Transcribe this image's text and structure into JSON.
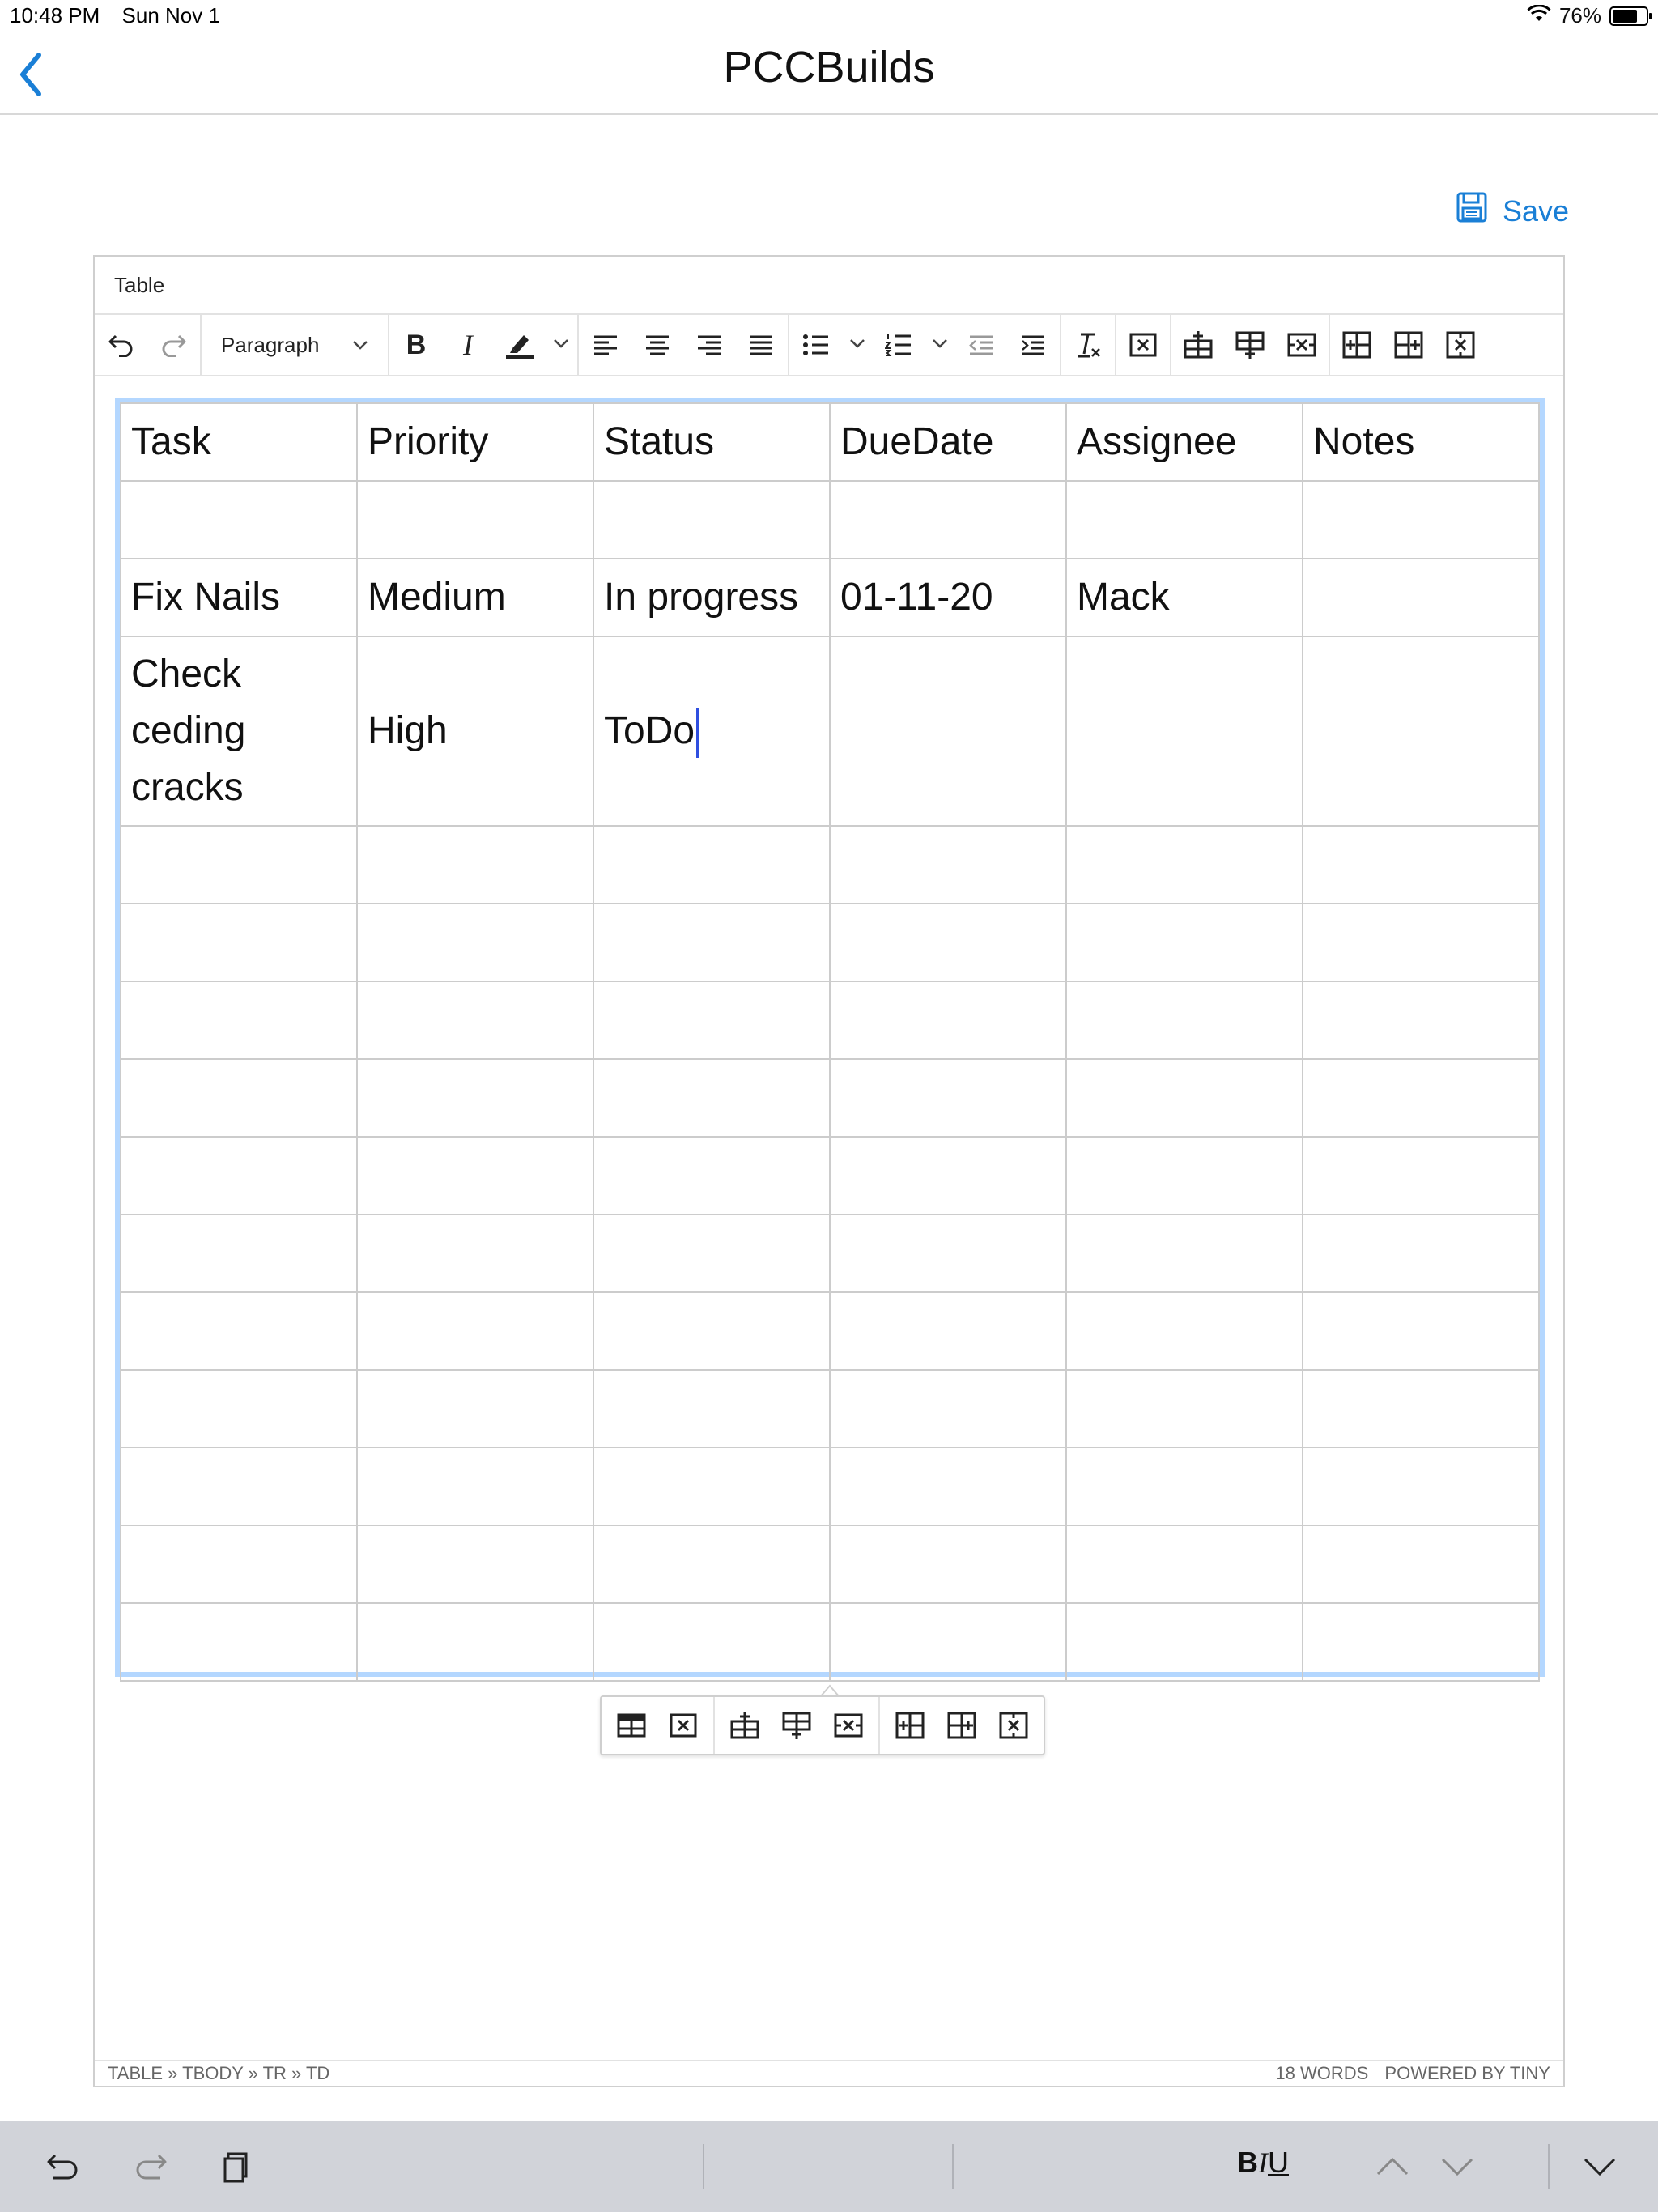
{
  "status_bar": {
    "time": "10:48 PM",
    "date": "Sun Nov 1",
    "battery": "76%"
  },
  "nav": {
    "title": "PCCBuilds",
    "back_icon": "chevron-left-icon"
  },
  "save": {
    "label": "Save",
    "icon": "floppy-disk-icon",
    "color": "#1a7fd6"
  },
  "editor": {
    "menubar": {
      "items": [
        "Table"
      ]
    },
    "toolbar": {
      "format_select": "Paragraph",
      "bold_label": "B",
      "italic_label": "I"
    },
    "table": {
      "rows": [
        [
          "Task",
          "Priority",
          "Status",
          "DueDate",
          "Assignee",
          "Notes"
        ],
        [
          "",
          "",
          "",
          "",
          "",
          ""
        ],
        [
          "Fix Nails",
          "Medium",
          "In progress",
          "01-11-20",
          "Mack",
          ""
        ],
        [
          "Check ceding cracks",
          "High",
          "ToDo",
          "",
          "",
          ""
        ],
        [
          "",
          "",
          "",
          "",
          "",
          ""
        ],
        [
          "",
          "",
          "",
          "",
          "",
          ""
        ],
        [
          "",
          "",
          "",
          "",
          "",
          ""
        ],
        [
          "",
          "",
          "",
          "",
          "",
          ""
        ],
        [
          "",
          "",
          "",
          "",
          "",
          ""
        ],
        [
          "",
          "",
          "",
          "",
          "",
          ""
        ],
        [
          "",
          "",
          "",
          "",
          "",
          ""
        ],
        [
          "",
          "",
          "",
          "",
          "",
          ""
        ],
        [
          "",
          "",
          "",
          "",
          "",
          ""
        ],
        [
          "",
          "",
          "",
          "",
          "",
          ""
        ],
        [
          "",
          "",
          "",
          "",
          "",
          ""
        ]
      ]
    },
    "statusbar": {
      "path": "TABLE » TBODY » TR » TD",
      "word_count": "18 WORDS",
      "powered_by": "POWERED BY TINY"
    }
  },
  "keyboard_bar": {
    "biu_bold": "B",
    "biu_italic": "I",
    "biu_underline": "U"
  }
}
